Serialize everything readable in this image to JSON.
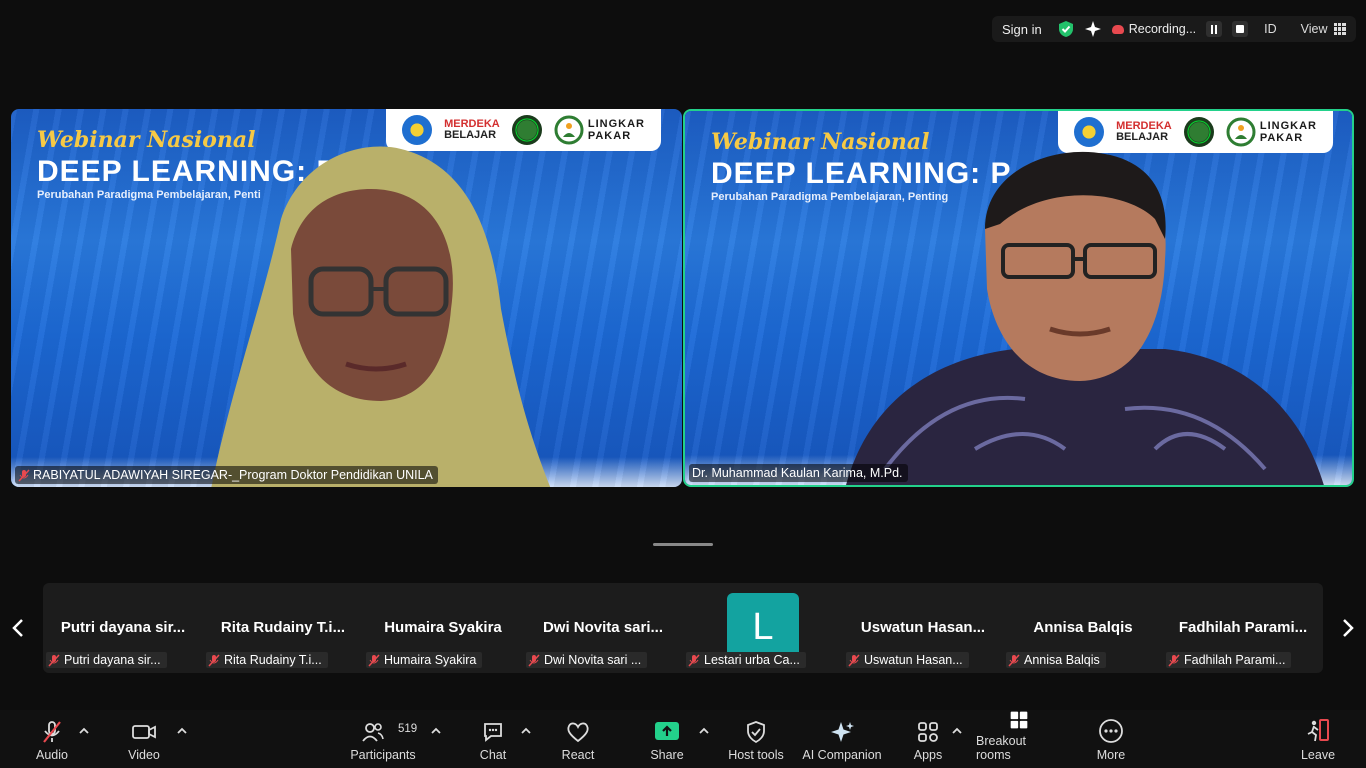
{
  "topbar": {
    "sign_in": "Sign in",
    "recording": "Recording...",
    "id": "ID",
    "view": "View"
  },
  "tiles": [
    {
      "webinar": "Webinar Nasional",
      "headline": "DEEP LEARNING: P",
      "subtitle": "Perubahan Paradigma Pembelajaran, Penti",
      "logo_merdeka_top": "MERDEKA",
      "logo_merdeka_bottom": "BELAJAR",
      "logo_lingkar_top": "LINGKAR",
      "logo_lingkar_bottom": "PAKAR",
      "name": "RABIYATUL ADAWIYAH SIREGAR-_Program Doktor Pendidikan UNILA"
    },
    {
      "webinar": "Webinar Nasional",
      "headline": "DEEP LEARNING: P",
      "subtitle": "Perubahan Paradigma Pembelajaran, Penting",
      "logo_merdeka_top": "MERDEKA",
      "logo_merdeka_bottom": "BELAJAR",
      "logo_lingkar_top": "LINGKAR",
      "logo_lingkar_bottom": "PAKAR",
      "name": "Dr. Muhammad Kaulan Karima, M.Pd."
    }
  ],
  "thumbnails": [
    {
      "display": "Putri dayana sir...",
      "label": "Putri dayana sir..."
    },
    {
      "display": "Rita Rudainy T.i...",
      "label": "Rita Rudainy T.i..."
    },
    {
      "display": "Humaira Syakira",
      "label": "Humaira Syakira"
    },
    {
      "display": "Dwi Novita sari...",
      "label": "Dwi Novita sari ..."
    },
    {
      "display": "L",
      "label": "Lestari urba Ca..."
    },
    {
      "display": "Uswatun Hasan...",
      "label": "Uswatun Hasan..."
    },
    {
      "display": "Annisa Balqis",
      "label": "Annisa Balqis"
    },
    {
      "display": "Fadhilah Parami...",
      "label": "Fadhilah Parami..."
    }
  ],
  "toolbar": {
    "audio": "Audio",
    "video": "Video",
    "participants": "Participants",
    "participants_count": "519",
    "chat": "Chat",
    "react": "React",
    "share": "Share",
    "host_tools": "Host tools",
    "ai_companion": "AI Companion",
    "apps": "Apps",
    "breakout_rooms": "Breakout rooms",
    "more": "More",
    "leave": "Leave"
  },
  "colors": {
    "active_speaker_border": "#23d18b",
    "share_green": "#23d18b",
    "mute_red": "#e8494f",
    "leave_red": "#e8494f",
    "avatar_teal": "#13a3a0"
  }
}
